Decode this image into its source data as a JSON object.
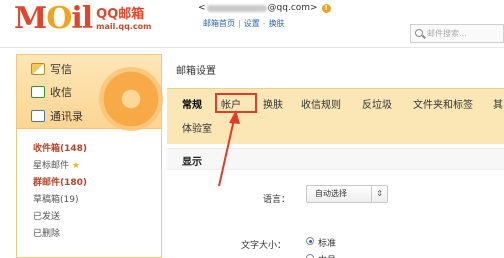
{
  "header": {
    "logo_mail": "M",
    "logo_o": "O",
    "logo_il": "il",
    "logo_qq": "QQ邮箱",
    "logo_domain": "mail.qq.com",
    "user_prefix": "<",
    "user_suffix": "@qq.com>",
    "links": [
      "邮箱首页",
      "设置",
      "换肤"
    ],
    "search_placeholder": "邮件搜索..."
  },
  "sidebar": {
    "actions": [
      {
        "label": "写信",
        "icon": "pen-icon"
      },
      {
        "label": "收信",
        "icon": "inbox-icon"
      },
      {
        "label": "通讯录",
        "icon": "contacts-icon"
      }
    ],
    "folders": [
      {
        "label": "收件箱(148)",
        "bold": true
      },
      {
        "label": "星标邮件",
        "star": "★"
      },
      {
        "label": "群邮件(180)",
        "bold": true
      },
      {
        "label": "草稿箱(19)"
      },
      {
        "label": "已发送"
      },
      {
        "label": "已删除"
      }
    ]
  },
  "main": {
    "title": "邮箱设置",
    "tabs": [
      "常规",
      "帐户",
      "换肤",
      "收信规则",
      "反垃圾",
      "文件夹和标签",
      "其"
    ],
    "tab_row2": "体验室",
    "section_title": "显示",
    "language_label": "语言：",
    "language_value": "自动选择",
    "font_size_label": "文字大小：",
    "font_options": [
      "标准",
      "中号"
    ]
  },
  "colors": {
    "accent": "#e2462a",
    "tabbar_bg": "#fbe6b6",
    "highlight_box": "#e23b2a"
  }
}
